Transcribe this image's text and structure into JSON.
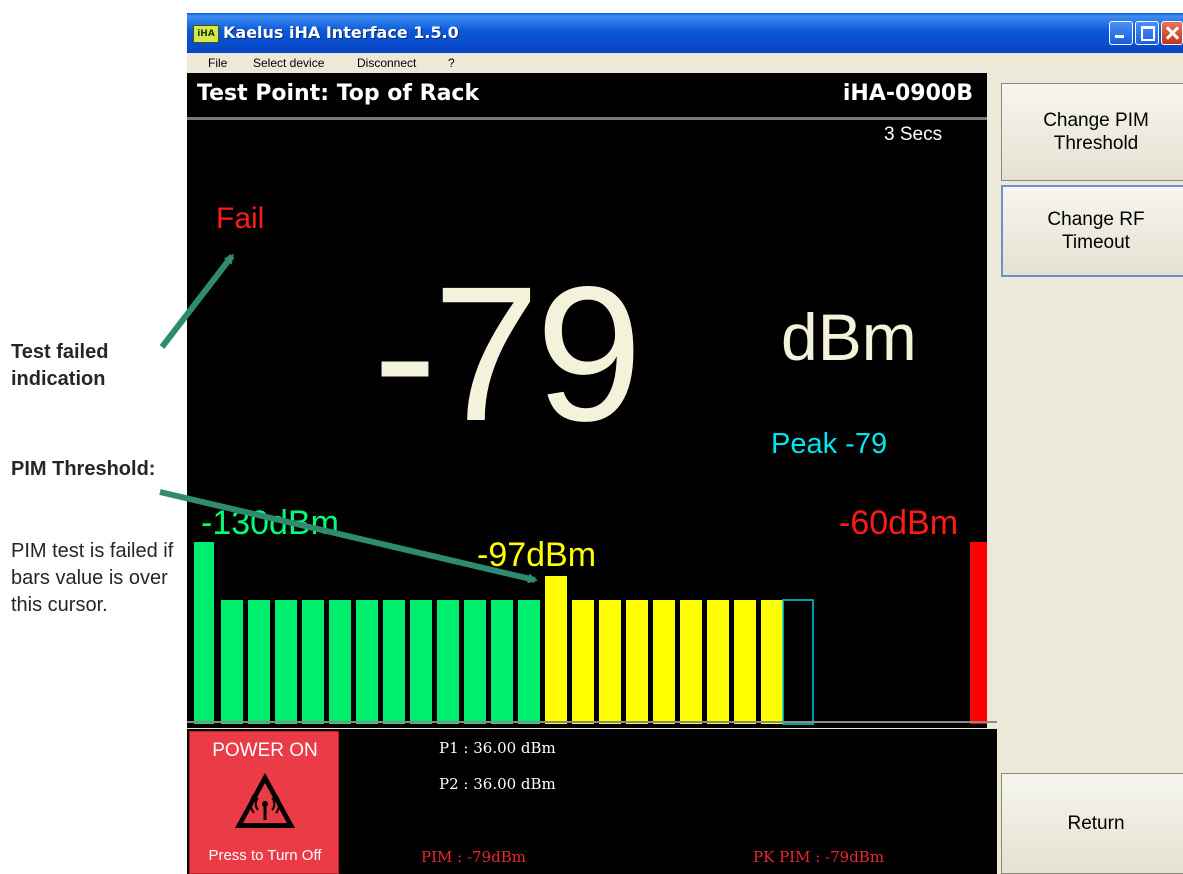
{
  "annotations": {
    "fail_note": "Test failed indication",
    "pim_title": "PIM Threshold:",
    "pim_desc": "PIM test is failed if bars value is over this cursor."
  },
  "window": {
    "title": "Kaelus iHA Interface 1.5.0",
    "icon_text": "iHA"
  },
  "menu": [
    "File",
    "Select device",
    "Disconnect",
    "?"
  ],
  "header": {
    "test_point": "Test Point: Top of Rack",
    "device": "iHA-0900B"
  },
  "display": {
    "timer": "3 Secs",
    "status": "Fail",
    "reading": "-79",
    "unit": "dBm",
    "peak": "Peak -79",
    "scale_min": "-130dBm",
    "scale_max": "-60dBm",
    "threshold_label": "-97dBm"
  },
  "bar_graph": {
    "scale_min_dbm": -130,
    "scale_max_dbm": -60,
    "threshold_dbm": -97,
    "bars_total": 22,
    "bars_lit": 21,
    "colors": {
      "below_threshold": "#00ee6e",
      "above_threshold": "#ffff00",
      "end_max": "#ff0000",
      "peak_outline": "#00d0e0"
    }
  },
  "bottom": {
    "power_label": "POWER ON",
    "power_hint": "Press to Turn Off",
    "p1": "P1 : 36.00 dBm",
    "p2": "P2 : 36.00 dBm",
    "pim": "PIM : -79dBm",
    "pk_pim": "PK PIM : -79dBm"
  },
  "side_buttons": {
    "change_pim": "Change PIM\nThreshold",
    "change_rf": "Change RF\nTimeout",
    "return": "Return"
  }
}
